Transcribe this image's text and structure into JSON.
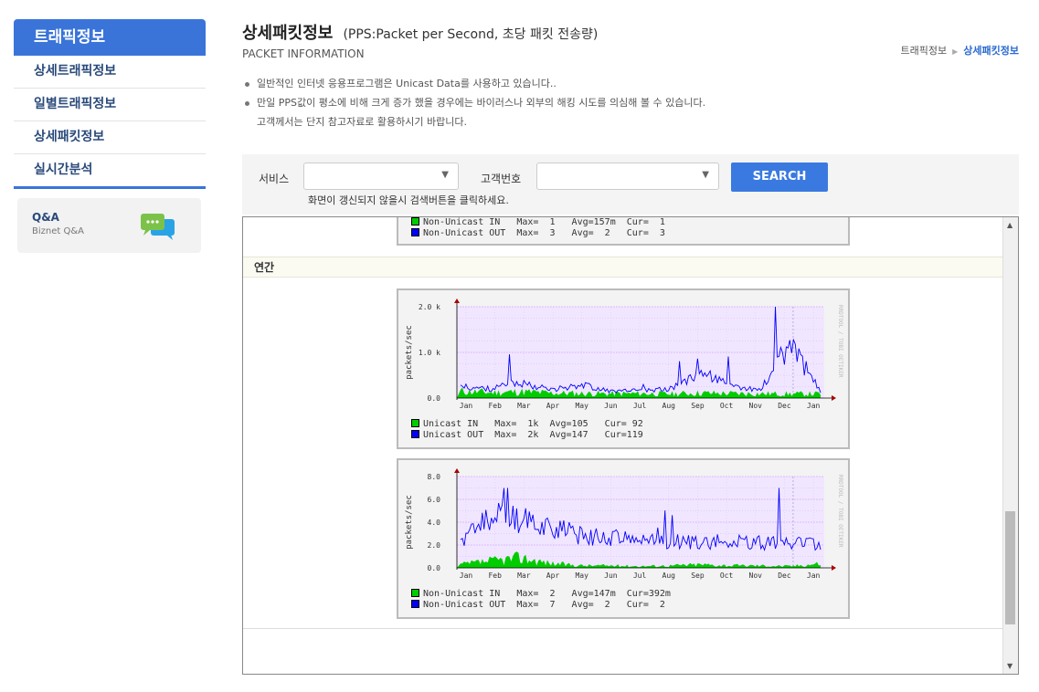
{
  "sidebar": {
    "title": "트래픽정보",
    "items": [
      "상세트래픽정보",
      "일별트래픽정보",
      "상세패킷정보",
      "실시간분석"
    ],
    "qa_title": "Q&A",
    "qa_sub": "Biznet Q&A"
  },
  "header": {
    "title": "상세패킷정보",
    "subtitle": "(PPS:Packet per Second, 초당 패킷 전송량)",
    "eng": "PACKET INFORMATION",
    "breadcrumb": [
      "트래픽정보",
      "상세패킷정보"
    ]
  },
  "notes": [
    "일반적인 인터넷 응용프로그램은 Unicast Data를 사용하고 있습니다..",
    "만일 PPS값이 평소에 비해 크게 증가 했을 경우에는 바이러스나 외부의 해킹 시도를 의심해 볼 수 있습니다.",
    "고객께서는 단지 참고자료로 활용하시기 바랍니다."
  ],
  "search": {
    "service_label": "서비스",
    "customer_label": "고객번호",
    "button": "SEARCH",
    "hint": "화면이 갱신되지 않을시 검색버튼을 클릭하세요."
  },
  "content": {
    "top_legend": [
      "Non-Unicast IN   Max=  1   Avg=157m  Cur=  1",
      "Non-Unicast OUT  Max=  3   Avg=  2   Cur=  3"
    ],
    "section": "연간",
    "watermark": "RRDTOOL / TOBI OETIKER",
    "graph1": {
      "ylabel": "packets/sec",
      "yticks": [
        "2.0 k",
        "1.0 k",
        "0.0"
      ],
      "legend": [
        "Unicast IN   Max=  1k  Avg=105   Cur= 92",
        "Unicast OUT  Max=  2k  Avg=147   Cur=119"
      ]
    },
    "graph2": {
      "ylabel": "packets/sec",
      "yticks": [
        "8.0",
        "6.0",
        "4.0",
        "2.0",
        "0.0"
      ],
      "legend": [
        "Non-Unicast IN   Max=  2   Avg=147m  Cur=392m",
        "Non-Unicast OUT  Max=  7   Avg=  2   Cur=  2"
      ]
    },
    "months": [
      "Jan",
      "Feb",
      "Mar",
      "Apr",
      "May",
      "Jun",
      "Jul",
      "Aug",
      "Sep",
      "Oct",
      "Nov",
      "Dec",
      "Jan"
    ]
  },
  "chart_data": [
    {
      "type": "area",
      "ylabel": "packets/sec",
      "x": [
        "Jan",
        "Feb",
        "Mar",
        "Apr",
        "May",
        "Jun",
        "Jul",
        "Aug",
        "Sep",
        "Oct",
        "Nov",
        "Dec",
        "Jan"
      ],
      "ylim": [
        0,
        2000
      ],
      "series": [
        {
          "name": "Unicast IN",
          "color": "#00cc00",
          "max": 1000,
          "avg": 105,
          "cur": 92,
          "values": [
            150,
            120,
            140,
            110,
            100,
            95,
            100,
            90,
            110,
            100,
            95,
            90,
            92
          ]
        },
        {
          "name": "Unicast OUT",
          "color": "#0000ff",
          "max": 2000,
          "avg": 147,
          "cur": 119,
          "values": [
            250,
            200,
            350,
            180,
            300,
            150,
            160,
            200,
            600,
            250,
            180,
            1200,
            119
          ]
        }
      ]
    },
    {
      "type": "area",
      "ylabel": "packets/sec",
      "x": [
        "Jan",
        "Feb",
        "Mar",
        "Apr",
        "May",
        "Jun",
        "Jul",
        "Aug",
        "Sep",
        "Oct",
        "Nov",
        "Dec",
        "Jan"
      ],
      "ylim": [
        0,
        8
      ],
      "series": [
        {
          "name": "Non-Unicast IN",
          "color": "#00cc00",
          "max": 2,
          "avg": 0.147,
          "cur": 0.392,
          "values": [
            0.3,
            0.6,
            0.9,
            0.4,
            0.2,
            0.2,
            0.15,
            0.2,
            0.3,
            0.2,
            0.2,
            0.15,
            0.39
          ]
        },
        {
          "name": "Non-Unicast OUT",
          "color": "#0000ff",
          "max": 7,
          "avg": 2,
          "cur": 2,
          "values": [
            2.2,
            4.5,
            4.2,
            3.8,
            2.8,
            2.6,
            2.5,
            2.3,
            2.3,
            2.3,
            2.2,
            2.2,
            2.0
          ]
        }
      ]
    }
  ]
}
